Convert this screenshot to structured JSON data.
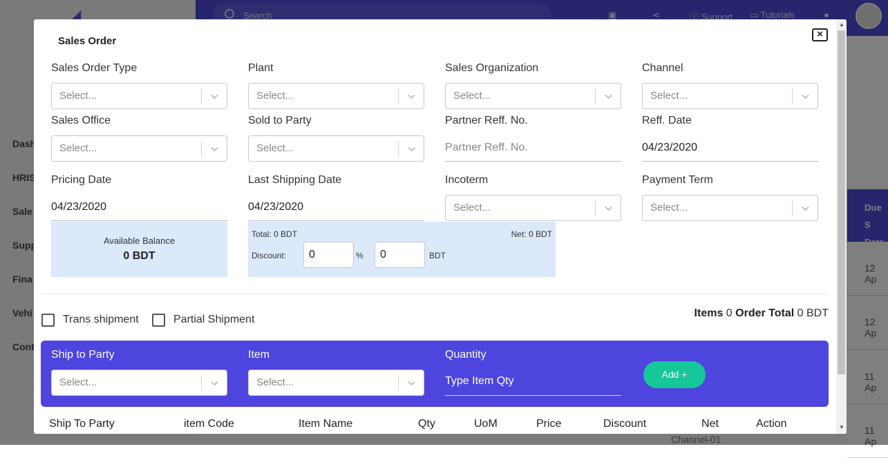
{
  "background": {
    "search_placeholder": "Search",
    "support_label": "Support",
    "tutorials_label": "Tutorials",
    "sidebar_items": [
      "Dash",
      "HRIS",
      "Sale",
      "Supp",
      "Fina",
      "Vehi",
      "Cont"
    ],
    "table_header": "Due S Date",
    "table_rows": [
      "12 Ap",
      "12 Ap",
      "11 Ap",
      "11 Ap"
    ],
    "bottom_text": "Channel-01"
  },
  "modal": {
    "title": "Sales Order",
    "close_symbol": "×",
    "fields": {
      "sales_order_type": {
        "label": "Sales Order Type",
        "placeholder": "Select..."
      },
      "plant": {
        "label": "Plant",
        "placeholder": "Select..."
      },
      "sales_organization": {
        "label": "Sales Organization",
        "placeholder": "Select..."
      },
      "channel": {
        "label": "Channel",
        "placeholder": "Select..."
      },
      "sales_office": {
        "label": "Sales Office",
        "placeholder": "Select..."
      },
      "sold_to_party": {
        "label": "Sold to Party",
        "placeholder": "Select..."
      },
      "partner_reff_no": {
        "label": "Partner Reff. No.",
        "placeholder": "Partner Reff. No."
      },
      "reff_date": {
        "label": "Reff. Date",
        "value": "04/23/2020"
      },
      "pricing_date": {
        "label": "Pricing Date",
        "value": "04/23/2020"
      },
      "last_shipping_date": {
        "label": "Last Shipping Date",
        "value": "04/23/2020"
      },
      "incoterm": {
        "label": "Incoterm",
        "placeholder": "Select..."
      },
      "payment_term": {
        "label": "Payment Term",
        "placeholder": "Select..."
      }
    },
    "balance": {
      "title": "Available Balance",
      "value": "0 BDT"
    },
    "totals": {
      "total": "Total: 0 BDT",
      "net": "Net: 0 BDT",
      "discount_label": "Discount:",
      "discount_percent": "0",
      "percent_sign": "%",
      "discount_amount": "0",
      "currency": "BDT"
    },
    "trans_shipment_label": "Trans shipment",
    "partial_shipment_label": "Partial Shipment",
    "summary": {
      "items_label": "Items",
      "items_count": "0",
      "order_total_label": "Order Total",
      "order_total_value": "0 BDT"
    },
    "add_panel": {
      "ship_to_party": {
        "label": "Ship to Party",
        "placeholder": "Select..."
      },
      "item": {
        "label": "Item",
        "placeholder": "Select..."
      },
      "quantity": {
        "label": "Quantity",
        "placeholder": "Type Item Qty"
      },
      "add_button": "Add +"
    },
    "table_headers": [
      "Ship To Party",
      "item Code",
      "Item Name",
      "Qty",
      "UoM",
      "Price",
      "Discount",
      "Net",
      "Action"
    ]
  }
}
